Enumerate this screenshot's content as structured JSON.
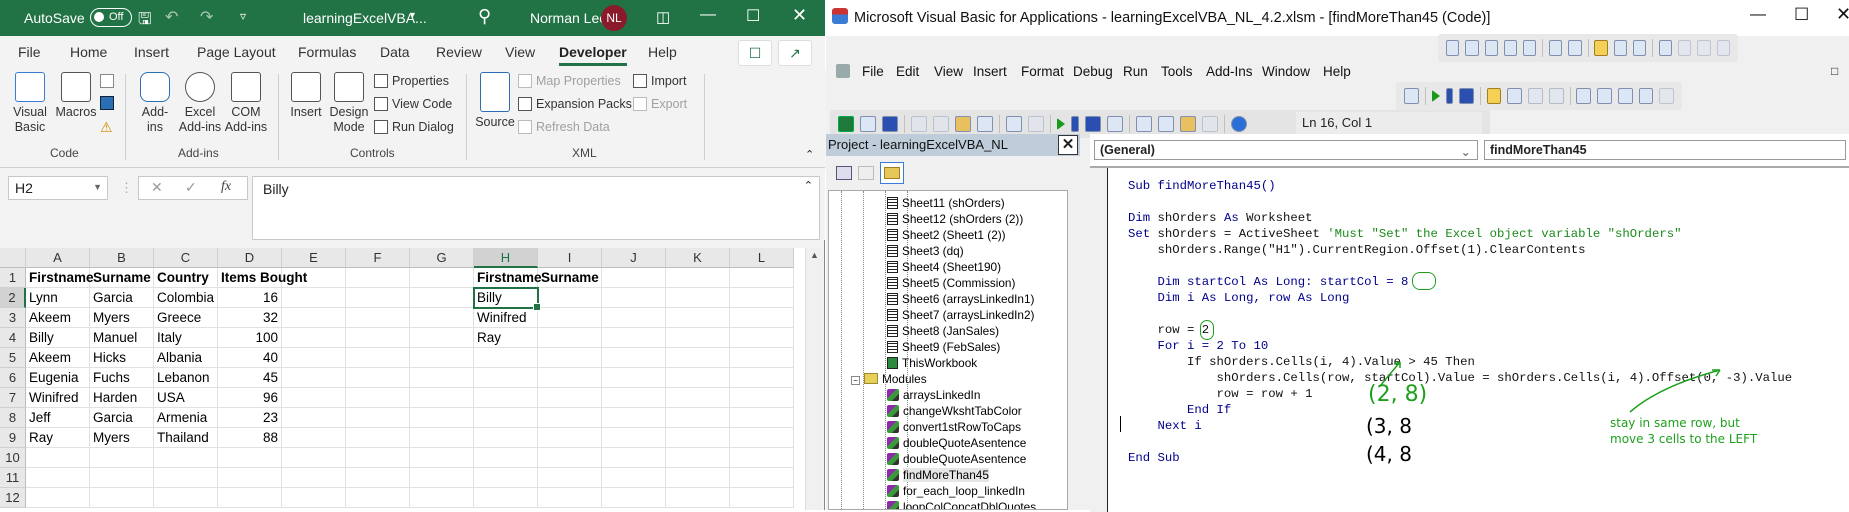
{
  "excel": {
    "titlebar": {
      "autosave_label": "AutoSave",
      "autosave_state": "Off",
      "filename": "learningExcelVBA...",
      "user_name": "Norman Lee",
      "user_initials": "NL"
    },
    "tabs": [
      "File",
      "Home",
      "Insert",
      "Page Layout",
      "Formulas",
      "Data",
      "Review",
      "View",
      "Developer",
      "Help"
    ],
    "active_tab": "Developer",
    "ribbon": {
      "code_group": {
        "label": "Code",
        "visual_basic": "Visual Basic",
        "macros": "Macros"
      },
      "addins_group": {
        "label": "Add-ins",
        "addins": "Add-ins",
        "excel_addins": "Excel Add-ins",
        "com_addins": "COM Add-ins"
      },
      "controls_group": {
        "label": "Controls",
        "insert": "Insert",
        "design_mode": "Design Mode",
        "properties": "Properties",
        "view_code": "View Code",
        "run_dialog": "Run Dialog"
      },
      "xml_group": {
        "label": "XML",
        "source": "Source",
        "map_properties": "Map Properties",
        "expansion_packs": "Expansion Packs",
        "refresh_data": "Refresh Data",
        "import": "Import",
        "export": "Export"
      }
    },
    "name_box": "H2",
    "fx_label": "fx",
    "formula_value": "Billy",
    "columns": [
      "A",
      "B",
      "C",
      "D",
      "E",
      "F",
      "G",
      "H",
      "I",
      "J",
      "K",
      "L"
    ],
    "selected_column": "H",
    "rows": [
      "1",
      "2",
      "3",
      "4",
      "5",
      "6",
      "7",
      "8",
      "9",
      "10",
      "11",
      "12"
    ],
    "selected_row": "2",
    "table": {
      "headers": [
        "Firstname",
        "Surname",
        "Country",
        "Items Bought"
      ],
      "data": [
        [
          "Lynn",
          "Garcia",
          "Colombia",
          "16"
        ],
        [
          "Akeem",
          "Myers",
          "Greece",
          "32"
        ],
        [
          "Billy",
          "Manuel",
          "Italy",
          "100"
        ],
        [
          "Akeem",
          "Hicks",
          "Albania",
          "40"
        ],
        [
          "Eugenia",
          "Fuchs",
          "Lebanon",
          "45"
        ],
        [
          "Winifred",
          "Harden",
          "USA",
          "96"
        ],
        [
          "Jeff",
          "Garcia",
          "Armenia",
          "23"
        ],
        [
          "Ray",
          "Myers",
          "Thailand",
          "88"
        ]
      ]
    },
    "output": {
      "headers": [
        "Firstname",
        "Surname"
      ],
      "values": [
        "Billy",
        "Winifred",
        "Ray"
      ]
    }
  },
  "vba": {
    "title": "Microsoft Visual Basic for Applications - learningExcelVBA_NL_4.2.xlsm - [findMoreThan45 (Code)]",
    "menu": [
      "File",
      "Edit",
      "View",
      "Insert",
      "Format",
      "Debug",
      "Run",
      "Tools",
      "Add-Ins",
      "Window",
      "Help"
    ],
    "cursor_position": "Ln 16, Col 1",
    "project_title": "Project - learningExcelVBA_NL",
    "tree": {
      "sheets": [
        "Sheet11 (shOrders)",
        "Sheet12 (shOrders (2))",
        "Sheet2 (Sheet1 (2))",
        "Sheet3 (dq)",
        "Sheet4 (Sheet190)",
        "Sheet5 (Commission)",
        "Sheet6 (arraysLinkedIn1)",
        "Sheet7 (arraysLinkedIn2)",
        "Sheet8 (JanSales)",
        "Sheet9 (FebSales)"
      ],
      "workbook": "ThisWorkbook",
      "modules_folder": "Modules",
      "modules": [
        "arraysLinkedIn",
        "changeWkshtTabColor",
        "convert1stRowToCaps",
        "doubleQuoteAsentence",
        "doubleQuoteAsentence",
        "findMoreThan45",
        "for_each_loop_linkedIn",
        "loopColConcatDblQuotes"
      ],
      "selected_module": "findMoreThan45"
    },
    "object_combo": "(General)",
    "proc_combo": "findMoreThan45",
    "code": {
      "l1": "Sub findMoreThan45()",
      "l2a": "Dim",
      "l2b": " shOrders ",
      "l2c": "As",
      "l2d": " Worksheet",
      "l3a": "Set",
      "l3b": " shOrders = ActiveSheet ",
      "l3c": "'Must \"Set\" the Excel object variable \"shOrders\"",
      "l4": "    shOrders.Range(\"H1\").CurrentRegion.Offset(1).ClearContents",
      "l5": "    Dim startCol As Long: startCol = 8",
      "l6": "    Dim i As Long, row As Long",
      "l7": "    row = 2",
      "l8": "    For i = 2 To 10",
      "l9": "        If shOrders.Cells(i, 4).Value > 45 Then",
      "l10": "            shOrders.Cells(row, startCol).Value = shOrders.Cells(i, 4).Offset(0, -3).Value",
      "l11": "            row = row + 1",
      "l12": "        End If",
      "l13": "    Next i",
      "l14": "End Sub"
    },
    "annotations": {
      "coord1": "(2, 8)",
      "coord2": "(3, 8",
      "coord3": "(4, 8",
      "note_line1": "stay in same row, but",
      "note_line2": "move 3 cells to the LEFT",
      "note_color": "#1ea01e"
    }
  }
}
